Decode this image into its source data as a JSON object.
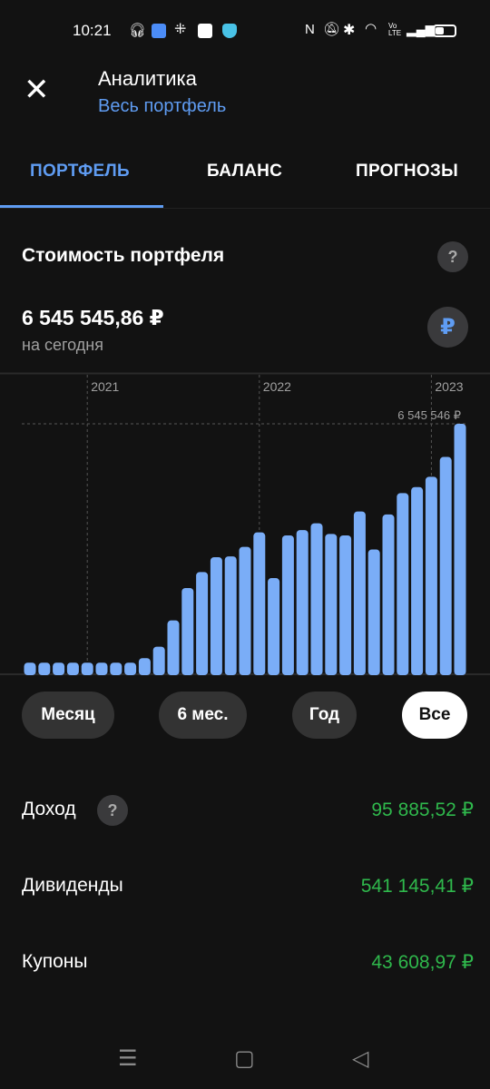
{
  "status_bar": {
    "time": "10:21",
    "icons": [
      "headphones-icon",
      "app-icon",
      "grid-icon",
      "inv-app-icon",
      "shield-icon",
      "nfc-icon",
      "bell-muted-icon",
      "bluetooth-icon",
      "wifi-icon",
      "volte-icon",
      "signal-icon",
      "battery-icon"
    ],
    "volte": "Vo LTE"
  },
  "header": {
    "title": "Аналитика",
    "subtitle": "Весь портфель",
    "close_icon": "close-icon"
  },
  "tabs": [
    {
      "label": "ПОРТФЕЛЬ",
      "active": true
    },
    {
      "label": "БАЛАНС"
    },
    {
      "label": "ПРОГНОЗЫ"
    }
  ],
  "portfolio": {
    "title": "Стоимость портфеля",
    "help": "?",
    "value": "6 545 545,86 ₽",
    "value_sub": "на сегодня",
    "currency_button": "₽"
  },
  "chart_data": {
    "type": "bar",
    "year_labels": [
      {
        "label": "2021",
        "index": 4
      },
      {
        "label": "2022",
        "index": 16
      },
      {
        "label": "2023",
        "index": 28
      }
    ],
    "max_label": "6 545 546 ₽",
    "values": [
      0.28,
      0.28,
      0.28,
      0.28,
      0.28,
      0.28,
      0.28,
      0.28,
      0.4,
      0.7,
      1.39,
      2.24,
      2.66,
      3.05,
      3.07,
      3.32,
      3.7,
      2.5,
      3.62,
      3.76,
      3.94,
      3.66,
      3.62,
      4.25,
      3.25,
      4.17,
      4.73,
      4.89,
      5.16,
      5.68,
      6.55
    ],
    "unit": "млн ₽",
    "ylim": [
      0,
      6.55
    ],
    "color": "#7aadf7",
    "grid": "vertical dashed at years"
  },
  "periods": [
    {
      "label": "Месяц"
    },
    {
      "label": "6 мес."
    },
    {
      "label": "Год"
    },
    {
      "label": "Все",
      "active": true
    }
  ],
  "stats": [
    {
      "label": "Доход",
      "value": "95 885,52 ₽",
      "help": "?"
    },
    {
      "label": "Дивиденды",
      "value": "541 145,41 ₽"
    },
    {
      "label": "Купоны",
      "value": "43 608,97 ₽"
    }
  ],
  "colors": {
    "accent": "#5f9cf2",
    "positive": "#2fb84c",
    "bar": "#7aadf7"
  },
  "nav": {
    "menu": "☰",
    "home": "▢",
    "back": "◁"
  }
}
